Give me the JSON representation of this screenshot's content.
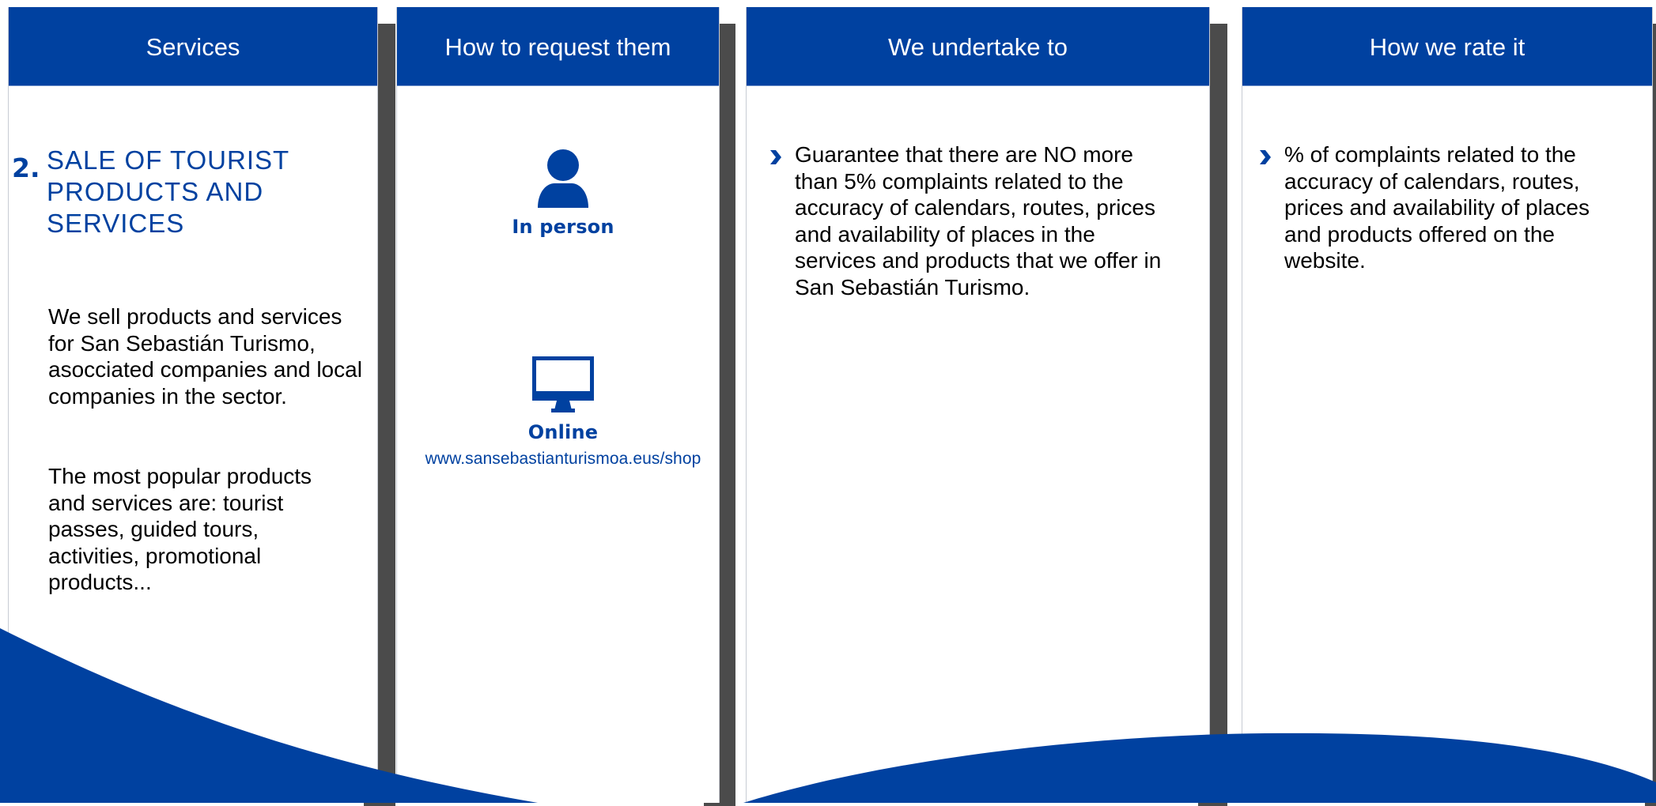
{
  "colors": {
    "brand_blue": "#0041a0",
    "shadow_gray": "#4b4b4b",
    "text": "#000000"
  },
  "columns": {
    "services": {
      "header": "Services",
      "number": "2.",
      "title": "SALE OF TOURIST PRODUCTS AND SERVICES",
      "paragraph_1": "We sell products and services for San Sebastián Turismo, asocciated companies and local companies in the sector.",
      "paragraph_2": "The most popular products and services are: tourist passes, guided tours, activities, promotional products..."
    },
    "request": {
      "header": "How to request them",
      "methods": [
        {
          "icon": "person-icon",
          "label": "In person"
        },
        {
          "icon": "monitor-icon",
          "label": "Online",
          "link": "www.sansebastianturismoa.eus/shop"
        }
      ]
    },
    "undertake": {
      "header": "We undertake to",
      "bullets": [
        "Guarantee that there are NO more than 5% complaints related to the accuracy of calendars, routes, prices and availability of places in the services and products that we offer in San Sebastián Turismo."
      ]
    },
    "rate": {
      "header": "How we rate it",
      "bullets": [
        "% of complaints related to the accuracy of calendars, routes, prices and availability of places and products offered on the website."
      ]
    }
  }
}
